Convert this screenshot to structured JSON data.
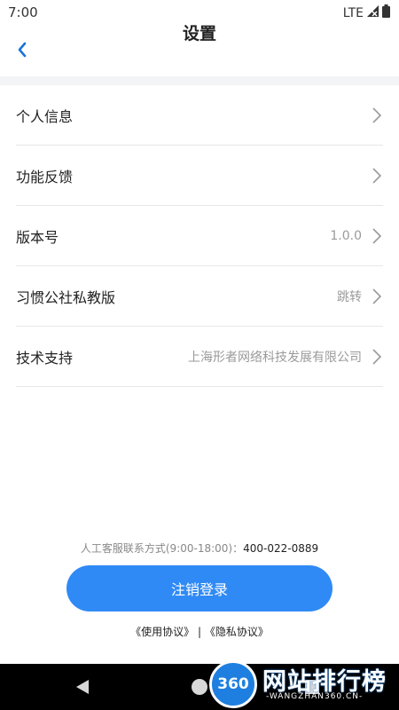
{
  "status_bar": {
    "time": "7:00",
    "network": "LTE"
  },
  "header": {
    "title": "设置"
  },
  "settings": [
    {
      "label": "个人信息",
      "value": ""
    },
    {
      "label": "功能反馈",
      "value": ""
    },
    {
      "label": "版本号",
      "value": "1.0.0"
    },
    {
      "label": "习惯公社私教版",
      "value": "跳转"
    },
    {
      "label": "技术支持",
      "value": "上海形者网络科技发展有限公司"
    }
  ],
  "contact": {
    "text": "人工客服联系方式(9:00-18:00)：",
    "phone": "400-022-0889"
  },
  "logout_label": "注销登录",
  "agreements": {
    "terms": "《使用协议》",
    "separator": "|",
    "privacy": "《隐私协议》"
  },
  "watermark": {
    "badge": "360",
    "text": "网站排行榜",
    "sub": "-WANGZHAN360.CN-"
  },
  "colors": {
    "accent": "#2f8af5",
    "nav_bar": "#000000",
    "divider_band": "#f3f4f6"
  }
}
